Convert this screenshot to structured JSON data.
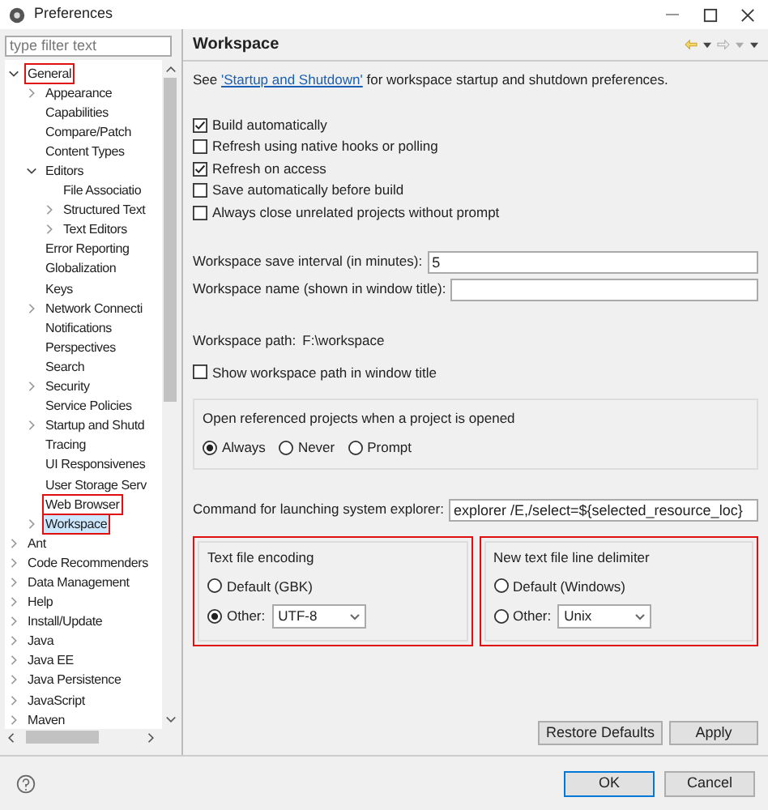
{
  "window": {
    "title": "Preferences"
  },
  "filter": {
    "placeholder": "type filter text"
  },
  "tree": [
    {
      "label": "General",
      "expanded": true,
      "selected": false,
      "annotated": true,
      "children": [
        {
          "label": "Appearance",
          "expanded": false,
          "selected": false,
          "annotated": false
        },
        {
          "label": "Capabilities",
          "selected": false,
          "annotated": false
        },
        {
          "label": "Compare/Patch",
          "selected": false,
          "annotated": false
        },
        {
          "label": "Content Types",
          "selected": false,
          "annotated": false
        },
        {
          "label": "Editors",
          "expanded": true,
          "selected": false,
          "annotated": false,
          "children": [
            {
              "label": "File Associatio",
              "selected": false,
              "annotated": false
            },
            {
              "label": "Structured Text",
              "expanded": false,
              "selected": false,
              "annotated": false
            },
            {
              "label": "Text Editors",
              "expanded": false,
              "selected": false,
              "annotated": false
            }
          ]
        },
        {
          "label": "Error Reporting",
          "selected": false,
          "annotated": false
        },
        {
          "label": "Globalization",
          "selected": false,
          "annotated": false
        },
        {
          "label": "Keys",
          "selected": false,
          "annotated": false
        },
        {
          "label": "Network Connecti",
          "expanded": false,
          "selected": false,
          "annotated": false
        },
        {
          "label": "Notifications",
          "selected": false,
          "annotated": false
        },
        {
          "label": "Perspectives",
          "selected": false,
          "annotated": false
        },
        {
          "label": "Search",
          "selected": false,
          "annotated": false
        },
        {
          "label": "Security",
          "expanded": false,
          "selected": false,
          "annotated": false
        },
        {
          "label": "Service Policies",
          "selected": false,
          "annotated": false
        },
        {
          "label": "Startup and Shutd",
          "expanded": false,
          "selected": false,
          "annotated": false
        },
        {
          "label": "Tracing",
          "selected": false,
          "annotated": false
        },
        {
          "label": "UI Responsivenes",
          "selected": false,
          "annotated": false
        },
        {
          "label": "User Storage Serv",
          "selected": false,
          "annotated": false
        },
        {
          "label": "Web Browser",
          "selected": false,
          "annotated": true
        },
        {
          "label": "Workspace",
          "expanded": false,
          "selected": true,
          "annotated": true
        }
      ]
    },
    {
      "label": "Ant",
      "expanded": false,
      "selected": false,
      "annotated": false
    },
    {
      "label": "Code Recommenders",
      "expanded": false,
      "selected": false,
      "annotated": false
    },
    {
      "label": "Data Management",
      "expanded": false,
      "selected": false,
      "annotated": false
    },
    {
      "label": "Help",
      "expanded": false,
      "selected": false,
      "annotated": false
    },
    {
      "label": "Install/Update",
      "expanded": false,
      "selected": false,
      "annotated": false
    },
    {
      "label": "Java",
      "expanded": false,
      "selected": false,
      "annotated": false
    },
    {
      "label": "Java EE",
      "expanded": false,
      "selected": false,
      "annotated": false
    },
    {
      "label": "Java Persistence",
      "expanded": false,
      "selected": false,
      "annotated": false
    },
    {
      "label": "JavaScript",
      "expanded": false,
      "selected": false,
      "annotated": false
    },
    {
      "label": "Maven",
      "expanded": false,
      "selected": false,
      "annotated": false
    }
  ],
  "page": {
    "title": "Workspace",
    "intro": {
      "before": "See ",
      "link": "'Startup and Shutdown'",
      "after": " for workspace startup and shutdown preferences."
    },
    "checkboxes": [
      {
        "label": "Build automatically",
        "checked": true
      },
      {
        "label": "Refresh using native hooks or polling",
        "checked": false
      },
      {
        "label": "Refresh on access",
        "checked": true
      },
      {
        "label": "Save automatically before build",
        "checked": false
      },
      {
        "label": "Always close unrelated projects without prompt",
        "checked": false
      }
    ],
    "save_interval": {
      "label": "Workspace save interval (in minutes):",
      "value": "5"
    },
    "workspace_name": {
      "label": "Workspace name (shown in window title):"
    },
    "workspace_path": {
      "label": "Workspace path:",
      "value": "F:\\workspace"
    },
    "show_path": {
      "label": "Show workspace path in window title",
      "checked": false
    },
    "open_referenced": {
      "title": "Open referenced projects when a project is opened",
      "options": [
        {
          "label": "Always",
          "selected": true
        },
        {
          "label": "Never",
          "selected": false
        },
        {
          "label": "Prompt",
          "selected": false
        }
      ]
    },
    "explorer_command": {
      "label": "Command for launching system explorer:",
      "value": "explorer /E,/select=${selected_resource_loc}"
    },
    "groups": [
      {
        "title": "Text file encoding",
        "annotated": true,
        "default": {
          "label": "Default (GBK)",
          "selected": false
        },
        "other": {
          "label": "Other:",
          "selected": true,
          "value": "UTF-8"
        }
      },
      {
        "title": "New text file line delimiter",
        "annotated": true,
        "default": {
          "label": "Default (Windows)",
          "selected": false
        },
        "other": {
          "label": "Other:",
          "selected": false,
          "value": "Unix"
        }
      }
    ],
    "buttons": [
      "Restore Defaults",
      "Apply"
    ]
  },
  "dialog_buttons": [
    "OK",
    "Cancel"
  ]
}
